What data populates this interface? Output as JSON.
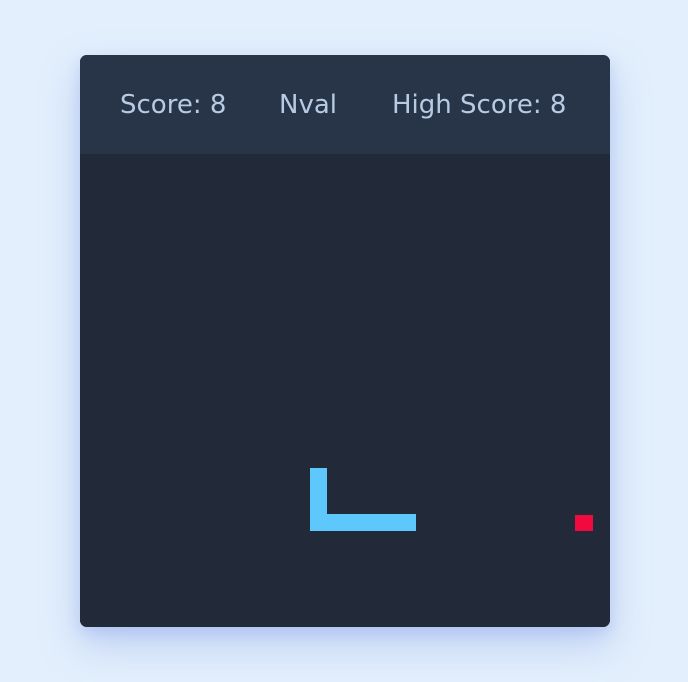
{
  "scoreboard": {
    "score": "Score: 8",
    "player": "Nval",
    "high_score": "High Score: 8"
  },
  "colors": {
    "page_background": "#e3effc",
    "board": "#222938",
    "header": "#283447",
    "text": "#b8cbe4",
    "snake": "#5ec8fc",
    "food": "#f20a3e"
  }
}
